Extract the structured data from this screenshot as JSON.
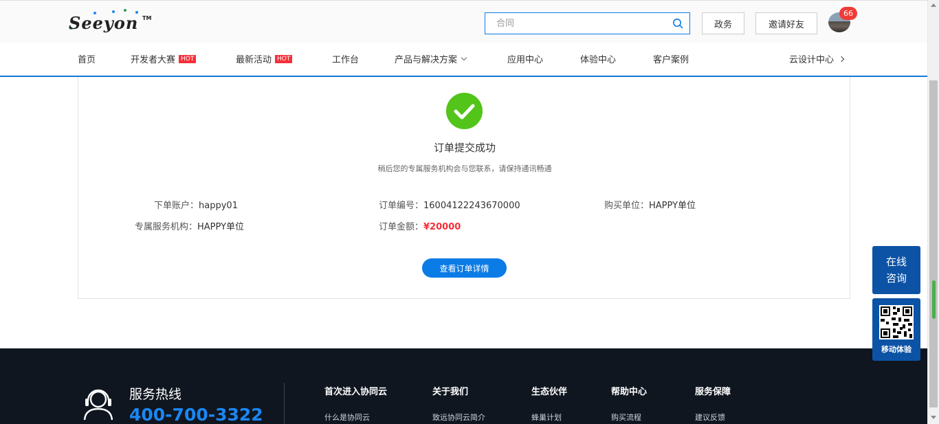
{
  "header": {
    "logo_text": "Seeyon",
    "logo_tm": "TM",
    "search_placeholder": "合同",
    "btn_gov": "政务",
    "btn_invite": "邀请好友",
    "notification_count": "66",
    "icons": {
      "search": "search-icon",
      "avatar": "user-avatar"
    }
  },
  "nav": {
    "items": [
      {
        "label": "首页"
      },
      {
        "label": "开发者大赛",
        "tag": "HOT"
      },
      {
        "label": "最新活动",
        "tag": "HOT"
      },
      {
        "label": "工作台"
      },
      {
        "label": "产品与解决方案"
      },
      {
        "label": "应用中心"
      },
      {
        "label": "体验中心"
      },
      {
        "label": "客户案例"
      },
      {
        "label": "云设计中心"
      }
    ]
  },
  "order": {
    "title": "订单提交成功",
    "subtitle": "稍后您的专属服务机构会与您联系，请保持通讯畅通",
    "account_label": "下单账户：",
    "account_value": "happy01",
    "number_label": "订单编号：",
    "number_value": "16004122243670000",
    "unit_label": "购买单位：",
    "unit_value": "HAPPY单位",
    "agency_label": "专属服务机构：",
    "agency_value": "HAPPY单位",
    "amount_label": "订单金额：",
    "amount_value": "¥20000",
    "detail_button": "查看订单详情"
  },
  "footer": {
    "hotline_label": "服务热线",
    "hotline_number": "400-700-3322",
    "columns": [
      {
        "heading": "首次进入协同云",
        "link": "什么是协同云"
      },
      {
        "heading": "关于我们",
        "link": "致远协同云简介"
      },
      {
        "heading": "生态伙伴",
        "link": "蜂巢计划"
      },
      {
        "heading": "帮助中心",
        "link": "购买流程"
      },
      {
        "heading": "服务保障",
        "link": "建议反馈"
      }
    ]
  },
  "float": {
    "online_line1": "在线",
    "online_line2": "咨询",
    "mobile_label": "移动体验"
  },
  "colors": {
    "accent": "#0b7be6",
    "success": "#52c41a",
    "price": "#f5303a",
    "footer_bg": "#0f1620",
    "float_bg": "#0c53a6"
  }
}
